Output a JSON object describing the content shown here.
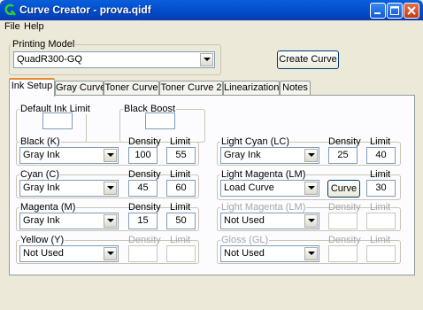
{
  "window": {
    "title": "Curve Creator - prova.qidf"
  },
  "menu": [
    "File",
    "Help"
  ],
  "printing_model": {
    "label": "Printing Model",
    "value": "QuadR300-GQ"
  },
  "create_curve_button": "Create Curve",
  "tabs": [
    "Ink Setup",
    "Gray Curve",
    "Toner Curve",
    "Toner Curve 2",
    "Linearization",
    "Notes"
  ],
  "column_labels": {
    "density": "Density",
    "limit": "Limit"
  },
  "default_ink_limit": {
    "label": "Default Ink Limit",
    "value": ""
  },
  "black_boost": {
    "label": "Black Boost",
    "value": ""
  },
  "channels": {
    "black": {
      "label": "Black (K)",
      "mode": "Gray Ink",
      "density": "100",
      "limit": "55"
    },
    "cyan": {
      "label": "Cyan (C)",
      "mode": "Gray Ink",
      "density": "45",
      "limit": "60"
    },
    "magenta": {
      "label": "Magenta (M)",
      "mode": "Gray Ink",
      "density": "15",
      "limit": "50"
    },
    "yellow": {
      "label": "Yellow (Y)",
      "mode": "Not Used",
      "density": "",
      "limit": ""
    },
    "light_cyan": {
      "label": "Light Cyan (LC)",
      "mode": "Gray Ink",
      "density": "25",
      "limit": "40"
    },
    "light_magenta": {
      "label": "Light Magenta (LM)",
      "mode": "Load Curve",
      "curve_button": "Curve",
      "limit": "30"
    },
    "light_magenta_2": {
      "label": "Light Magenta (LM)",
      "mode": "Not Used",
      "density": "",
      "limit": ""
    },
    "gloss": {
      "label": "Gloss (GL)",
      "mode": "Not Used",
      "density": "",
      "limit": ""
    }
  }
}
